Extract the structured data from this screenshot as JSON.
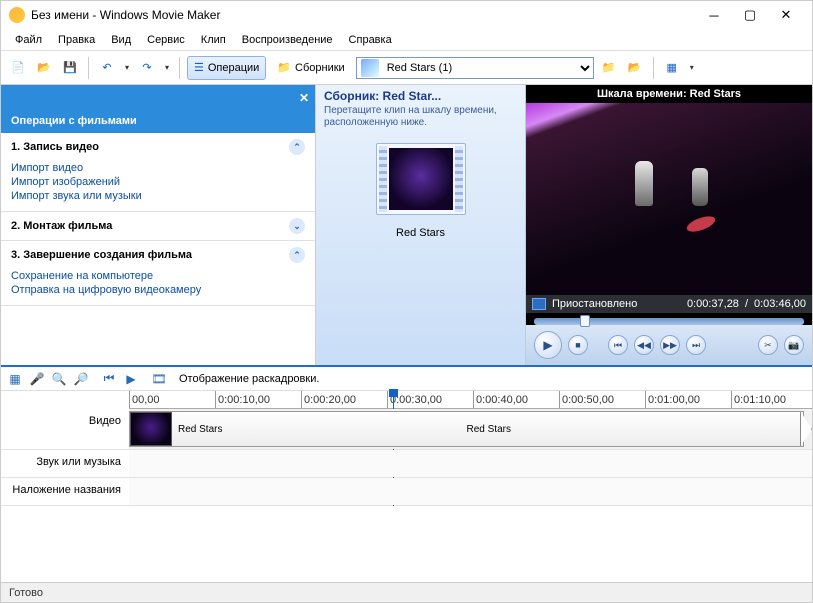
{
  "window": {
    "title": "Без имени - Windows Movie Maker"
  },
  "menu": {
    "file": "Файл",
    "edit": "Правка",
    "view": "Вид",
    "service": "Сервис",
    "clip": "Клип",
    "playback": "Воспроизведение",
    "help": "Справка"
  },
  "toolbar": {
    "operations": "Операции",
    "collections": "Сборники",
    "combo_selected": "Red Stars (1)"
  },
  "tasks": {
    "header": "Операции с фильмами",
    "sec1": {
      "title": "1. Запись видео",
      "links": [
        "Импорт видео",
        "Импорт изображений",
        "Импорт звука или музыки"
      ]
    },
    "sec2": {
      "title": "2. Монтаж фильма"
    },
    "sec3": {
      "title": "3. Завершение создания фильма",
      "links": [
        "Сохранение на компьютере",
        "Отправка на цифровую видеокамеру"
      ]
    }
  },
  "collection": {
    "title": "Сборник: Red Star...",
    "subtitle": "Перетащите клип на шкалу времени, расположенную ниже.",
    "clip_name": "Red Stars"
  },
  "preview": {
    "title": "Шкала времени: Red Stars",
    "status": "Приостановлено",
    "time_current": "0:00:37,28",
    "time_total": "0:03:46,00"
  },
  "timeline": {
    "toolbar_label": "Отображение раскадровки.",
    "ticks": [
      "00,00",
      "0:00:10,00",
      "0:00:20,00",
      "0:00:30,00",
      "0:00:40,00",
      "0:00:50,00",
      "0:01:00,00",
      "0:01:10,00"
    ],
    "tracks": {
      "video": "Видео",
      "audio": "Звук или музыка",
      "title": "Наложение названия"
    },
    "clip1": "Red Stars",
    "clip2": "Red Stars"
  },
  "statusbar": {
    "text": "Готово"
  }
}
